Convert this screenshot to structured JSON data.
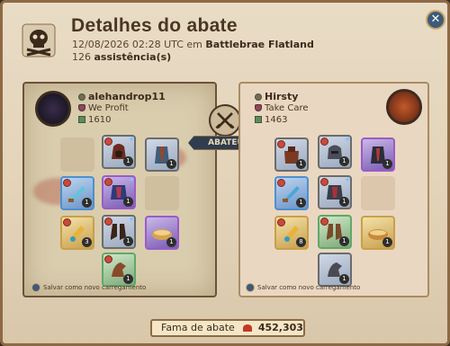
{
  "header": {
    "title": "Detalhes do abate",
    "datetime": "12/08/2026 02:28 UTC em",
    "location": "Battlebrae Flatland",
    "assist_count": "126",
    "assist_label": "assistência(s)"
  },
  "killer": {
    "name": "alehandrop11",
    "guild": "We Profit",
    "ip": "1610",
    "save_label": "Salvar como novo carregamento"
  },
  "victim": {
    "name": "Hirsty",
    "guild": "Take Care",
    "ip": "1463",
    "save_label": "Salvar como novo carregamento"
  },
  "center": {
    "badge_label": "ABATEU"
  },
  "footer": {
    "fame_label": "Fama de abate",
    "fame_value": "452,303"
  },
  "colors": {
    "accent_blue": "#3d5a7a",
    "parchment": "#e9dcc5",
    "border_brown": "#8d6a45"
  },
  "icons": [
    "skull-crossbones-icon",
    "close-icon",
    "crossed-swords-icon",
    "fame-icon"
  ]
}
